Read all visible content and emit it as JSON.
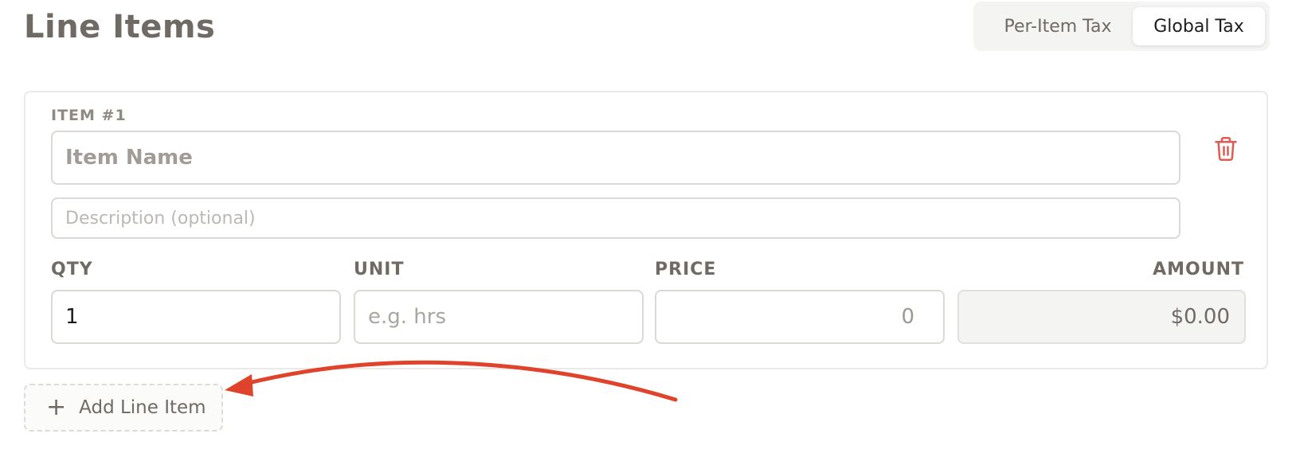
{
  "header": {
    "title": "Line Items"
  },
  "tax_toggle": {
    "options": [
      {
        "label": "Per-Item Tax",
        "selected": false
      },
      {
        "label": "Global Tax",
        "selected": true
      }
    ]
  },
  "line_items": [
    {
      "label": "ITEM #1",
      "name_placeholder": "Item Name",
      "description_placeholder": "Description (optional)",
      "qty_label": "QTY",
      "qty_value": "1",
      "unit_label": "UNIT",
      "unit_placeholder": "e.g. hrs",
      "price_label": "PRICE",
      "price_placeholder": "0",
      "amount_label": "AMOUNT",
      "amount_value": "$0.00"
    }
  ],
  "actions": {
    "add_line_item": "Add Line Item"
  },
  "icons": {
    "delete": "trash-icon",
    "add": "plus-icon",
    "annotation": "arrow-icon"
  },
  "colors": {
    "delete_icon": "#e05a52",
    "annotation_arrow": "#e0432c",
    "text": "#6f6a64"
  }
}
